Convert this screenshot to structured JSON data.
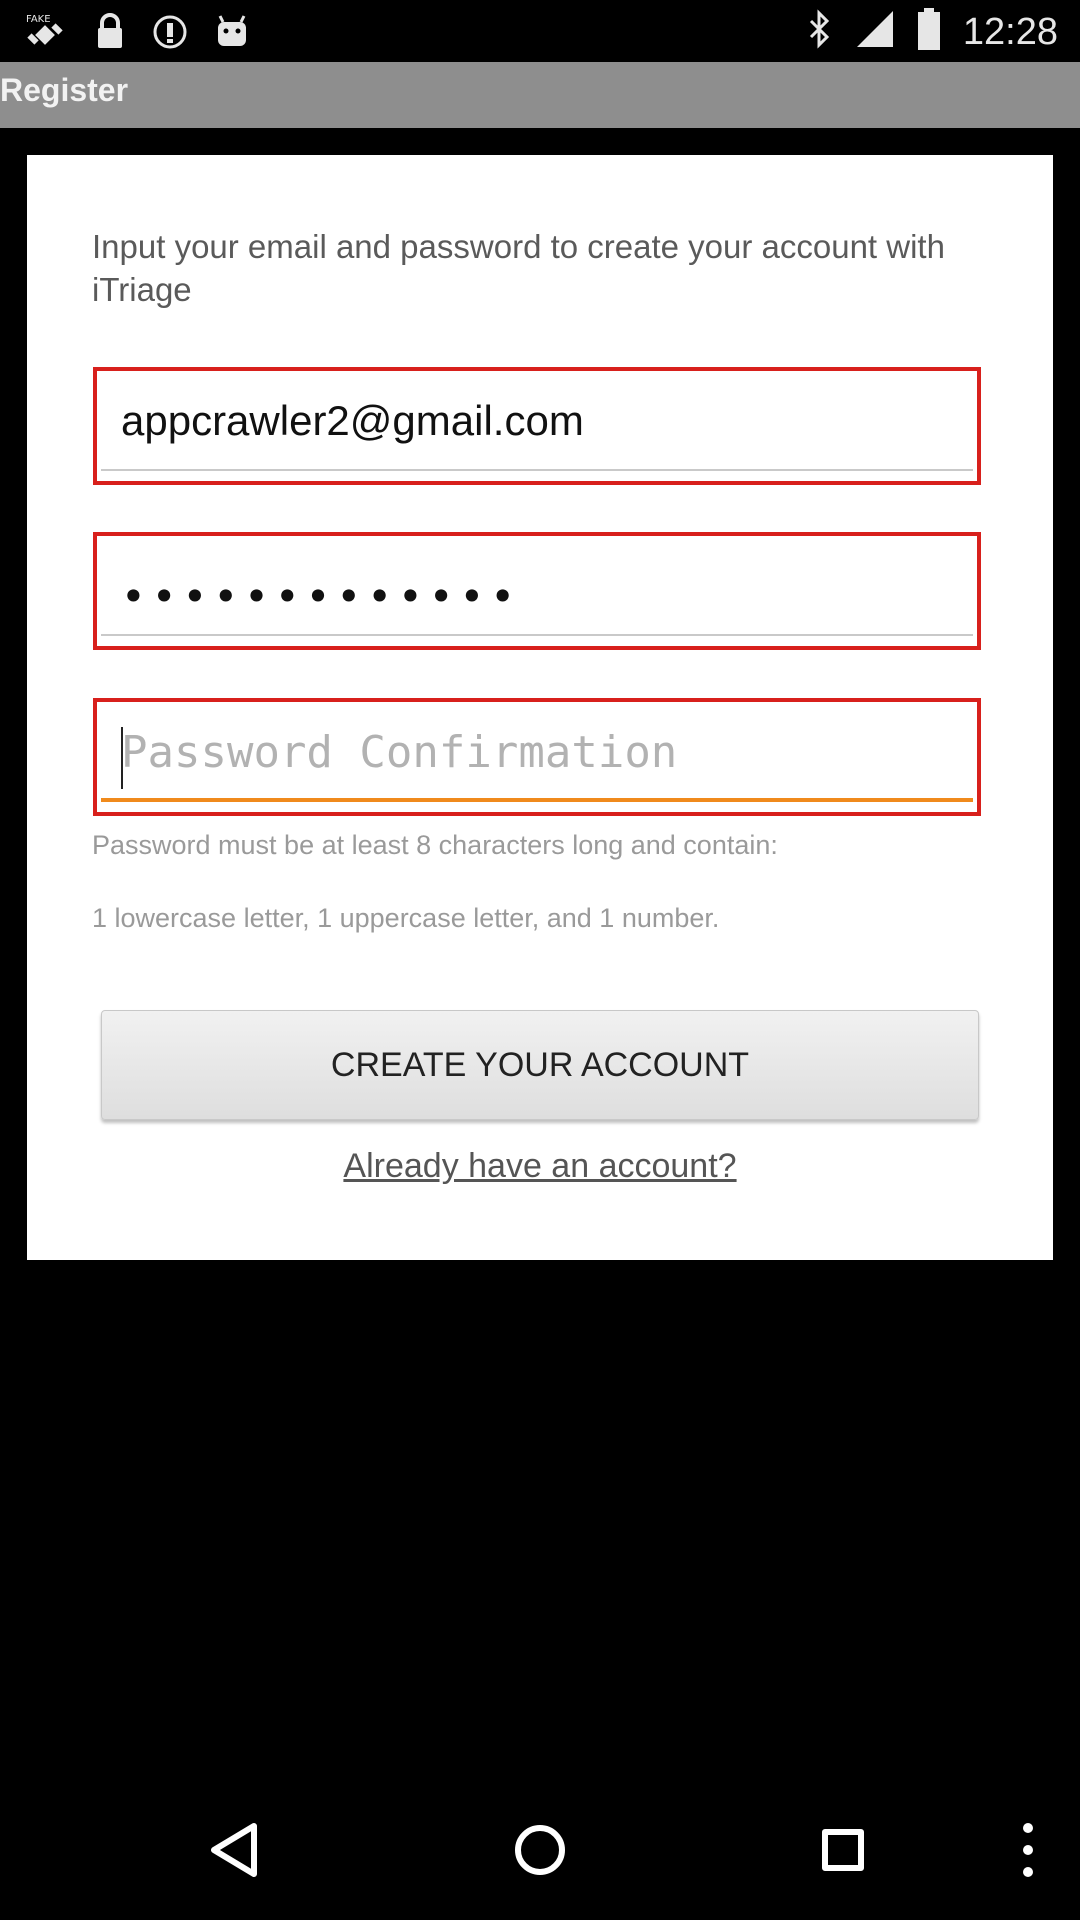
{
  "status_bar": {
    "time": "12:28",
    "left_icons": [
      "fake-gps-icon",
      "lock-icon",
      "info-circle-icon",
      "android-icon"
    ],
    "right_icons": [
      "bluetooth-icon",
      "signal-icon",
      "battery-icon"
    ]
  },
  "app_bar": {
    "title": "Register"
  },
  "form": {
    "intro": "Input your email and password to create your account with iTriage",
    "email": {
      "value": "appcrawler2@gmail.com"
    },
    "password": {
      "masked_value": "•••••••••••••"
    },
    "password_confirmation": {
      "value": "",
      "placeholder": "Password Confirmation"
    },
    "help_line_1": "Password must be at least 8 characters long and contain:",
    "help_line_2": "1 lowercase letter, 1 uppercase letter, and 1 number.",
    "create_button": "CREATE YOUR ACCOUNT",
    "already_link": "Already have an account?"
  },
  "nav_bar": {
    "buttons": [
      "back-icon",
      "home-icon",
      "recents-icon",
      "overflow-menu-icon"
    ]
  },
  "colors": {
    "error_border": "#d8201c",
    "focus_underline": "#f08a1c",
    "app_bar": "#8e8e8e"
  }
}
